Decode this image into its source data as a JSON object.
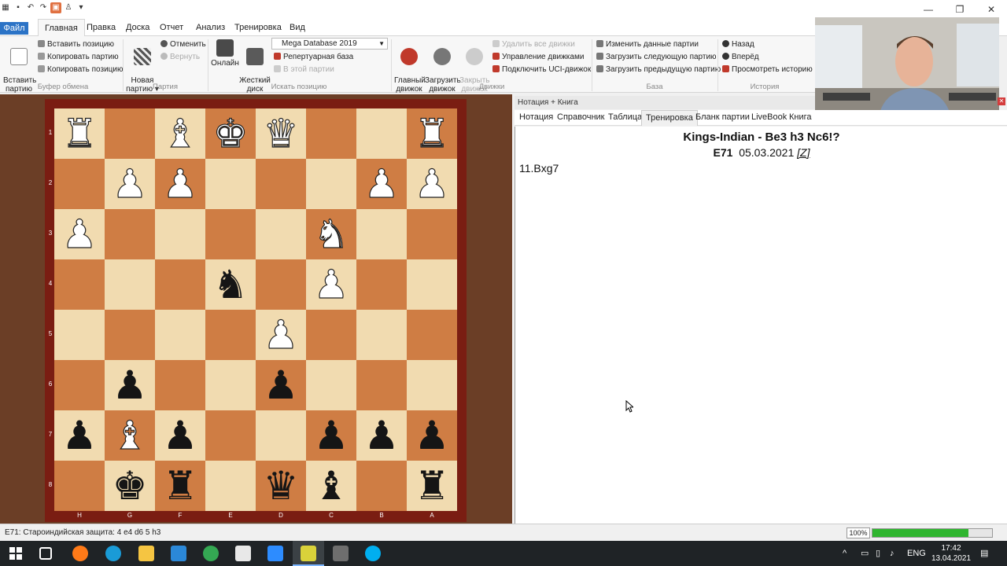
{
  "ribbon": {
    "tabs": [
      "Файл",
      "Главная",
      "Правка",
      "Доска",
      "Отчет",
      "Анализ",
      "Тренировка",
      "Вид"
    ],
    "clipboard": {
      "paste_game": "Вставить\nпартию",
      "paste_position": "Вставить позицию",
      "copy_game": "Копировать партию",
      "copy_position": "Копировать позицию",
      "label": "Буфер обмена"
    },
    "game": {
      "new_game": "Новая\nпартию",
      "undo": "Отменить",
      "redo": "Вернуть",
      "label": "Партия"
    },
    "search": {
      "online": "Онлайн",
      "hard_disk": "Жесткий\nдиск",
      "database_value": "Mega Database 2019",
      "repertoire_db": "Репертуарная база",
      "in_this_game": "В этой партии",
      "label": "Искать позицию"
    },
    "engines": {
      "main_engine": "Главный\nдвижок",
      "load_engine": "Загрузить\nдвижок",
      "close_engine": "Закрыть\nдвижок",
      "remove_all": "Удалить все движки",
      "manage": "Управление движками",
      "connect_uci": "Подключить UCI-движок",
      "label": "Движки"
    },
    "database": {
      "edit_game_data": "Изменить данные партии",
      "load_next": "Загрузить следующую партию",
      "load_previous": "Загрузить предыдущую партию",
      "label": "База"
    },
    "history": {
      "back": "Назад",
      "forward": "Вперёд",
      "view_history": "Просмотреть историю",
      "label": "История"
    }
  },
  "board": {
    "rank_labels": [
      "1",
      "2",
      "3",
      "4",
      "5",
      "6",
      "7",
      "8"
    ],
    "file_labels": [
      "H",
      "G",
      "F",
      "E",
      "D",
      "C",
      "B",
      "A"
    ],
    "rows": [
      [
        "wR",
        "",
        "wB",
        "wK",
        "wQ",
        "",
        "",
        "wR"
      ],
      [
        "",
        "wP",
        "wP",
        "",
        "",
        "",
        "wP",
        "wP"
      ],
      [
        "wP",
        "",
        "",
        "",
        "",
        "wN",
        "",
        ""
      ],
      [
        "",
        "",
        "",
        "bN",
        "",
        "wP",
        "",
        ""
      ],
      [
        "",
        "",
        "",
        "",
        "wP",
        "",
        "",
        ""
      ],
      [
        "",
        "bP",
        "",
        "",
        "bP",
        "",
        "",
        ""
      ],
      [
        "bP",
        "wB",
        "bP",
        "",
        "",
        "bP",
        "bP",
        "bP"
      ],
      [
        "",
        "bK",
        "bR",
        "",
        "bQ",
        "bB",
        "",
        "bR"
      ]
    ]
  },
  "notation_panel": {
    "title": "Нотация + Книга",
    "tabs": [
      "Нотация",
      "Справочник",
      "Таблица",
      "Тренировка",
      "Бланк партии",
      "LiveBook",
      "Книга"
    ],
    "selected_tab": "Тренировка",
    "game_title": "Kings-Indian - Be3 h3 Nc6!?",
    "eco": "E71",
    "date": "05.03.2021",
    "source": "[Z]",
    "moves": "11.Bxg7"
  },
  "status_bar": {
    "text": "E71: Староиндийская защита: 4 e4 d6 5 h3",
    "zoom": "100%",
    "progress": 0.8
  },
  "taskbar": {
    "language": "ENG",
    "time": "17:42",
    "date": "13.04.2021"
  },
  "colors": {
    "accent": "#2b73c6",
    "light_square": "#f1dbb0",
    "dark_square": "#cf7d44",
    "board_frame": "#7a1d12"
  }
}
